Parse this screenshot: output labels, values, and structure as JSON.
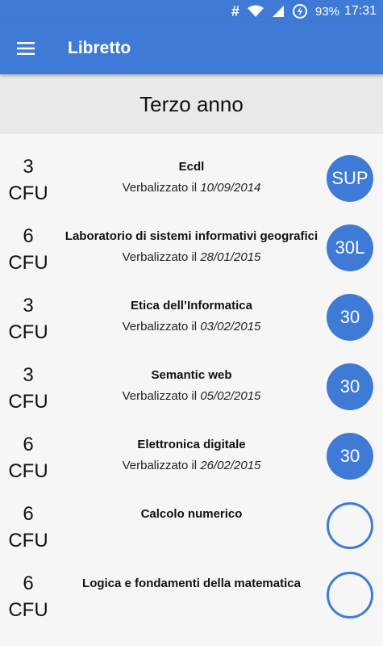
{
  "status_bar": {
    "hash_icon": "#",
    "battery_percent": "93%",
    "time": "17:31"
  },
  "app_bar": {
    "title": "Libretto",
    "menu_icon": "hamburger-menu-icon"
  },
  "section": {
    "title": "Terzo anno"
  },
  "exams": [
    {
      "cfu": "3",
      "cfu_unit": "CFU",
      "name": "Ecdl",
      "date_prefix": "Verbalizzato il ",
      "date": "10/09/2014",
      "grade": "SUP"
    },
    {
      "cfu": "6",
      "cfu_unit": "CFU",
      "name": "Laboratorio di sistemi informativi geografici",
      "date_prefix": "Verbalizzato il ",
      "date": "28/01/2015",
      "grade": "30L"
    },
    {
      "cfu": "3",
      "cfu_unit": "CFU",
      "name": "Etica dell’Informatica",
      "date_prefix": "Verbalizzato il ",
      "date": "03/02/2015",
      "grade": "30"
    },
    {
      "cfu": "3",
      "cfu_unit": "CFU",
      "name": "Semantic web",
      "date_prefix": "Verbalizzato il ",
      "date": "05/02/2015",
      "grade": "30"
    },
    {
      "cfu": "6",
      "cfu_unit": "CFU",
      "name": "Elettronica digitale",
      "date_prefix": "Verbalizzato il ",
      "date": "26/02/2015",
      "grade": "30"
    },
    {
      "cfu": "6",
      "cfu_unit": "CFU",
      "name": "Calcolo numerico",
      "date_prefix": "",
      "date": "",
      "grade": ""
    },
    {
      "cfu": "6",
      "cfu_unit": "CFU",
      "name": "Logica e fondamenti della matematica",
      "date_prefix": "",
      "date": "",
      "grade": ""
    }
  ],
  "colors": {
    "primary": "#3f7bd6",
    "header_bg": "#e9e9e9",
    "list_bg": "#f6f6f6"
  }
}
